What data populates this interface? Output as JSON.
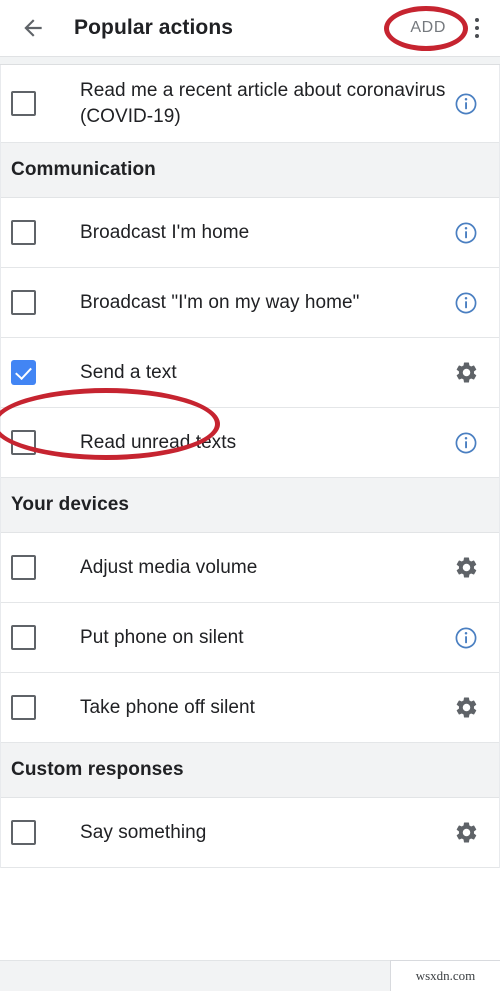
{
  "header": {
    "back_icon": "arrow-left-icon",
    "title": "Popular actions",
    "add_label": "ADD",
    "overflow_icon": "more-vert-icon"
  },
  "annotations": [
    {
      "name": "add-button-highlight",
      "color": "#c62430",
      "shape": "ellipse",
      "target": "ADD"
    },
    {
      "name": "send-a-text-highlight",
      "color": "#c62430",
      "shape": "ellipse",
      "target": "Send a text"
    }
  ],
  "colors": {
    "accent_blue": "#4285f4",
    "info_blue": "#4a7fc1",
    "gear_gray": "#5f6368",
    "annotation_red": "#c62430",
    "section_bg": "#f2f3f4",
    "text": "#202124"
  },
  "list": [
    {
      "type": "item",
      "label": "Read me a recent article about coronavirus (COVID-19)",
      "checked": false,
      "trailing": "info-icon"
    },
    {
      "type": "section",
      "label": "Communication"
    },
    {
      "type": "item",
      "label": "Broadcast I'm home",
      "checked": false,
      "trailing": "info-icon"
    },
    {
      "type": "item",
      "label": "Broadcast \"I'm on my way home\"",
      "checked": false,
      "trailing": "info-icon"
    },
    {
      "type": "item",
      "label": "Send a text",
      "checked": true,
      "trailing": "gear-icon"
    },
    {
      "type": "item",
      "label": "Read unread texts",
      "checked": false,
      "trailing": "info-icon"
    },
    {
      "type": "section",
      "label": "Your devices"
    },
    {
      "type": "item",
      "label": "Adjust media volume",
      "checked": false,
      "trailing": "gear-icon"
    },
    {
      "type": "item",
      "label": "Put phone on silent",
      "checked": false,
      "trailing": "info-icon"
    },
    {
      "type": "item",
      "label": "Take phone off silent",
      "checked": false,
      "trailing": "gear-icon"
    },
    {
      "type": "section",
      "label": "Custom responses"
    },
    {
      "type": "item",
      "label": "Say something",
      "checked": false,
      "trailing": "gear-icon"
    }
  ],
  "footer": {
    "watermark": "wsxdn.com"
  }
}
